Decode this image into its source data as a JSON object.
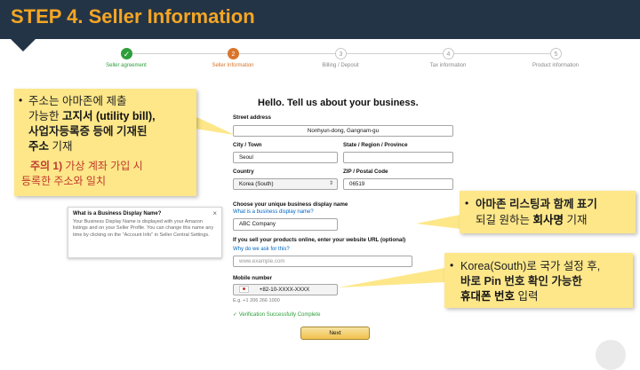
{
  "header": {
    "title": "STEP 4. Seller Information"
  },
  "steps": [
    {
      "label": "Seller agreement",
      "mark": "✓",
      "state": "done"
    },
    {
      "label": "Seller Information",
      "mark": "2",
      "state": "current"
    },
    {
      "label": "Billing / Deposit",
      "mark": "3",
      "state": "todo"
    },
    {
      "label": "Tax information",
      "mark": "4",
      "state": "todo"
    },
    {
      "label": "Product information",
      "mark": "5",
      "state": "todo"
    }
  ],
  "form": {
    "title": "Hello. Tell us about your business.",
    "street": {
      "label": "Street address",
      "value": "Nonhyun-dong, Gangnam-gu"
    },
    "city": {
      "label": "City / Town",
      "value": "Seoul"
    },
    "state": {
      "label": "State / Region / Province",
      "value": ""
    },
    "country": {
      "label": "Country",
      "value": "Korea (South)",
      "caret": "⇕"
    },
    "zip": {
      "label": "ZIP / Postal Code",
      "value": "06519"
    },
    "display_name": {
      "label": "Choose your unique business display name",
      "link": "What is a business display name?",
      "value": "ABC Company"
    },
    "website": {
      "label": "If you sell your products online, enter your website URL (optional)",
      "link": "Why do we ask for this?",
      "placeholder": "www.example.com"
    },
    "mobile": {
      "label": "Mobile number",
      "value": "+82-10-XXXX-XXXX",
      "hint": "E.g. +1 206 266 1000"
    },
    "verified": "✓ Verification Successfully Complete",
    "next": "Next"
  },
  "info_popup": {
    "title": "What is a Business Display Name?",
    "close": "×",
    "text": "Your Business Display Name is displayed with your Amazon listings and on your Seller Profile. You can change this name any time by clicking on the \"Account Info\" in Seller Central Settings."
  },
  "callouts": {
    "address": {
      "line1": "주소는 아마존에 제출",
      "line2a": "가능한 ",
      "line2b": "고지서 (utility bill),",
      "line3": "사업자등록증 등에 기재된",
      "line4a": "주소",
      "line4b": " 기재",
      "warn1a": "주의 1) ",
      "warn1b": "가상 계좌 가입 시",
      "warn2": "등록한 주소와 일치"
    },
    "display": {
      "line1": "아마존 리스팅과 함께 표기",
      "line2a": "되길 원하는 ",
      "line2b": "회사명",
      "line2c": " 기재"
    },
    "phone": {
      "line1": "Korea(South)로 국가 설정 후,",
      "line2": "바로 Pin 번호 확인 가능한",
      "line3a": "휴대폰 번호",
      "line3b": " 입력"
    }
  },
  "colors": {
    "header_bg": "#243447",
    "accent": "#f5a623",
    "callout_bg": "#fde789",
    "success": "#2e9e3a",
    "current_step": "#d9742a"
  }
}
